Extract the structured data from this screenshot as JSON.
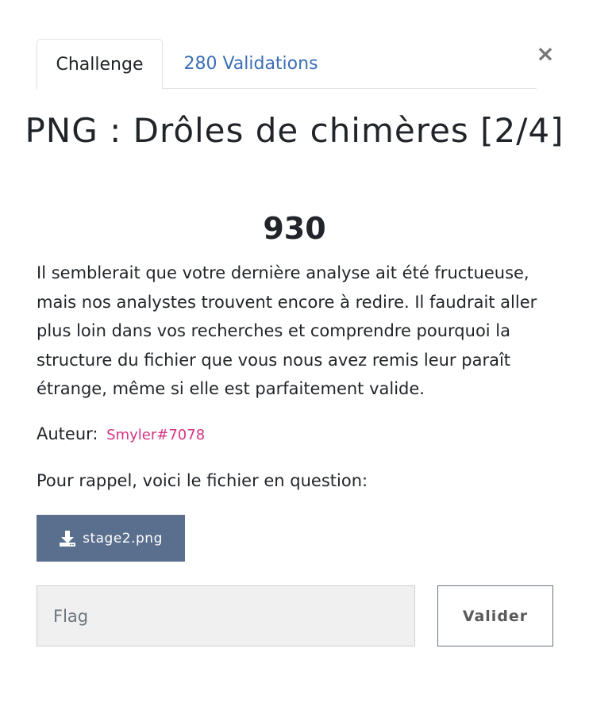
{
  "tabs": {
    "challenge_label": "Challenge",
    "validations_label": "280 Validations",
    "active": "Challenge"
  },
  "close_label": "×",
  "challenge": {
    "title": "PNG : Drôles de chimères [2/4]",
    "points": "930",
    "description": "Il semblerait que votre dernière analyse ait été fructueuse, mais nos analystes trouvent encore à redire. Il faudrait aller plus loin dans vos recherches et comprendre pourquoi la structure du fichier que vous nous avez remis leur paraît étrange, même si elle est parfaitement valide.",
    "author_label": "Auteur:",
    "author_name": "Smyler#7078",
    "reminder": "Pour rappel, voici le fichier en question:",
    "file_name": "stage2.png"
  },
  "flag_form": {
    "placeholder": "Flag",
    "value": "",
    "submit_label": "Valider"
  },
  "colors": {
    "link": "#3b6fb6",
    "author": "#d63384",
    "download_button": "#5a6f8d",
    "input_background": "#f0f0f0"
  },
  "icons": {
    "download": "download-icon",
    "close": "close-icon"
  }
}
